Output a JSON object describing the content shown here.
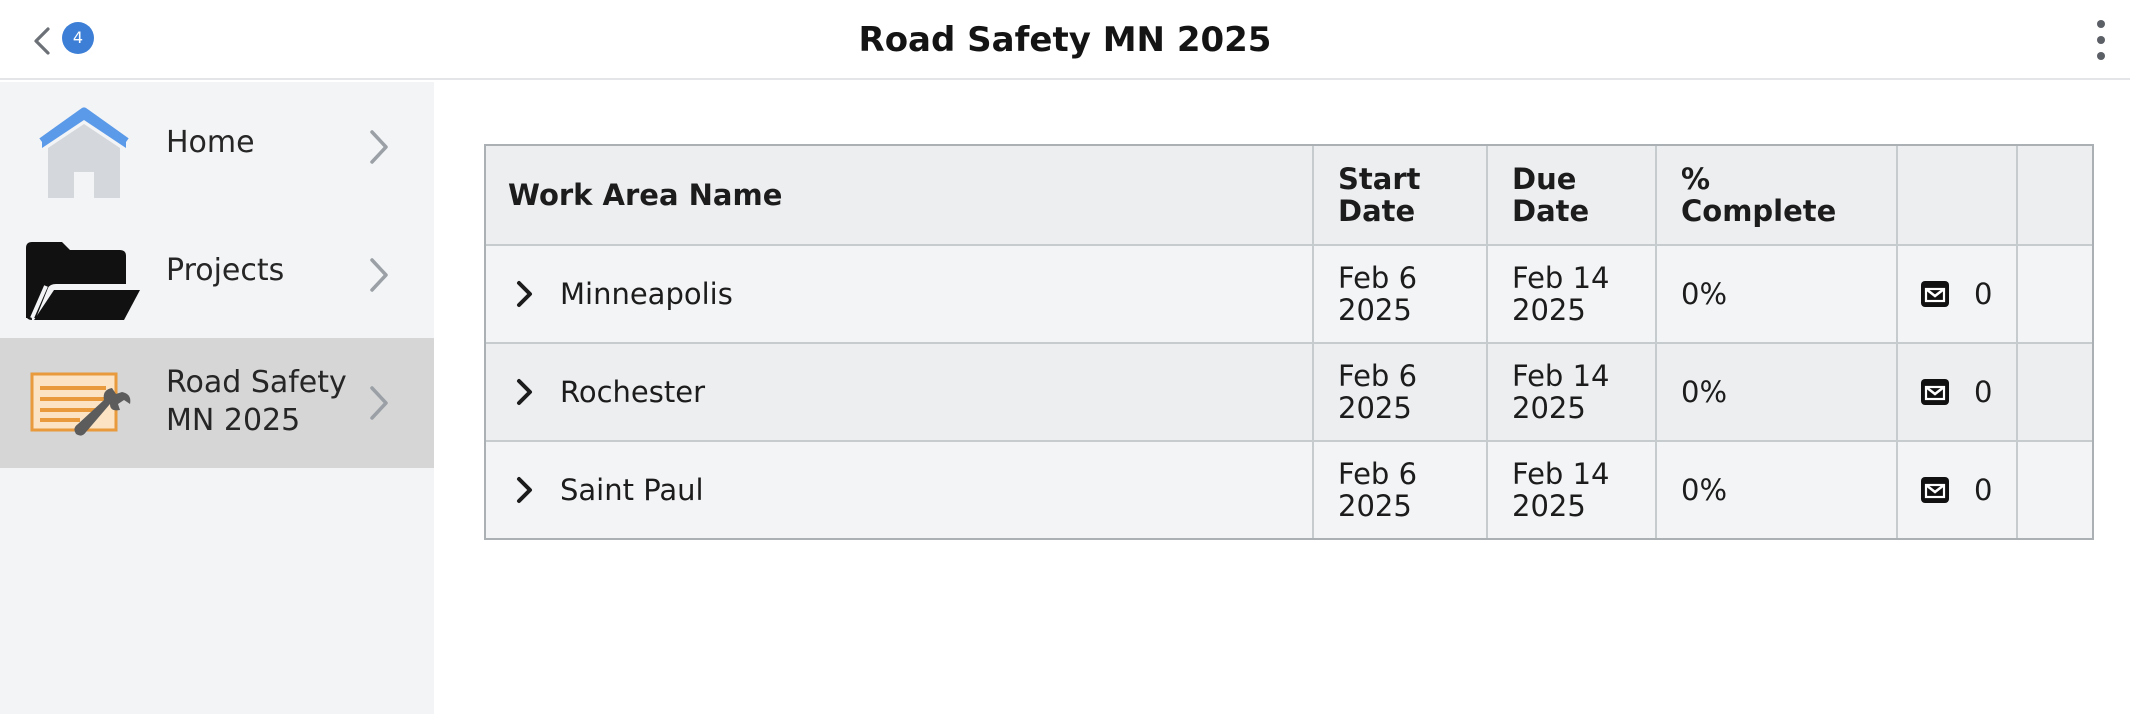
{
  "header": {
    "title": "Road Safety MN 2025",
    "back_badge": "4",
    "back_icon": "chevron-left-icon",
    "menu_icon": "vertical-dots-icon"
  },
  "sidebar": {
    "items": [
      {
        "label": "Home",
        "icon": "house-icon",
        "selected": false
      },
      {
        "label": "Projects",
        "icon": "folder-icon",
        "selected": false
      },
      {
        "label": "Road Safety MN 2025",
        "icon": "document-wrench-icon",
        "selected": true
      }
    ]
  },
  "table": {
    "columns": [
      "Work Area Name",
      "Start Date",
      "Due Date",
      "% Complete",
      "",
      ""
    ],
    "rows": [
      {
        "name": "Minneapolis",
        "start": "Feb 6 2025",
        "due": "Feb 14 2025",
        "pct": "0%",
        "messages": "0"
      },
      {
        "name": "Rochester",
        "start": "Feb 6 2025",
        "due": "Feb 14 2025",
        "pct": "0%",
        "messages": "0"
      },
      {
        "name": "Saint Paul",
        "start": "Feb 6 2025",
        "due": "Feb 14 2025",
        "pct": "0%",
        "messages": "0"
      }
    ]
  },
  "colors": {
    "accent": "#3d7fd6",
    "sidebar_bg": "#f3f4f6",
    "selected_bg": "#d6d6d6",
    "table_border": "#aab0b4"
  }
}
